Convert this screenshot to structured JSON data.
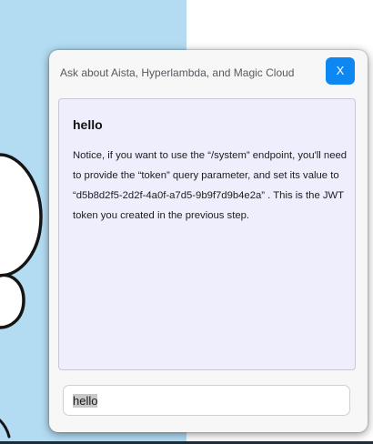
{
  "chat": {
    "title": "Ask about Aista, Hyperlambda, and Magic Cloud",
    "close_label": "X",
    "message": {
      "title": "hello",
      "body": "Notice, if you want to use the “/system” endpoint, you'll need to provide the “token” query parameter, and set its value to “d5b8d2f5-2d2f-4a0f-a7d5-9b9f7d9b4e2a” . This is the JWT token you created in the previous step."
    },
    "input": {
      "value": "hello"
    }
  },
  "colors": {
    "background_panel": "#b3dcf3",
    "close_button": "#0d87f2",
    "message_area": "#efeefd"
  }
}
